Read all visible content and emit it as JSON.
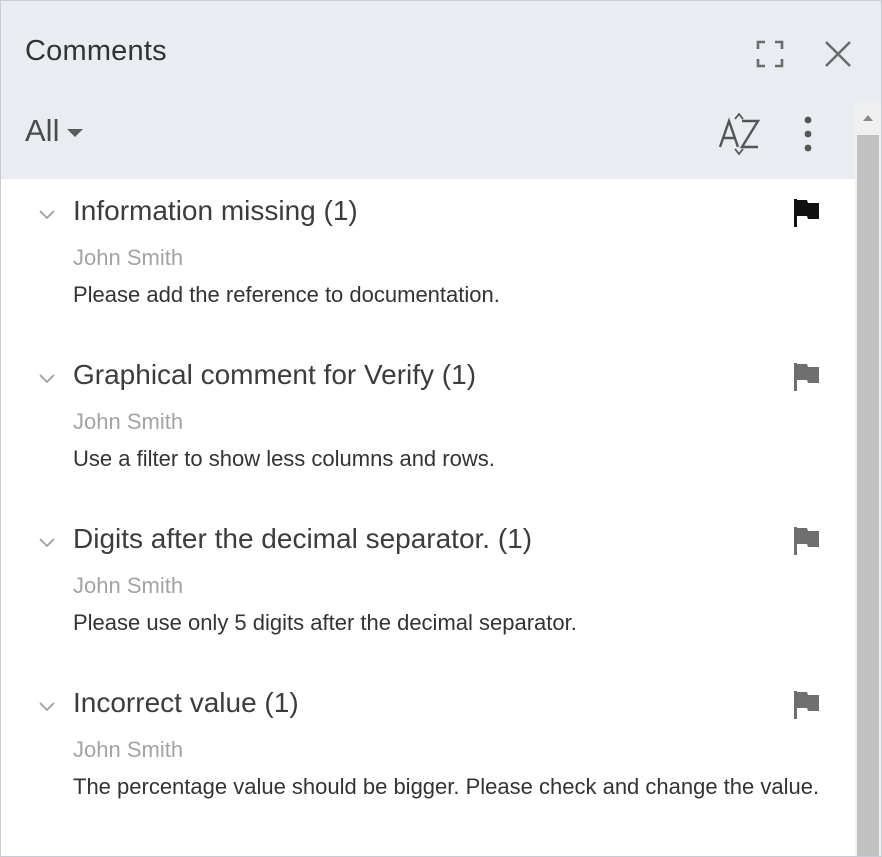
{
  "panel": {
    "title": "Comments",
    "filter": "All",
    "icons": {
      "expand": "expand-icon",
      "close": "close-icon",
      "sort": "sort-az-icon",
      "more": "more-vertical-icon",
      "flag": "flag-icon",
      "chevron": "chevron-down-icon"
    }
  },
  "comments": [
    {
      "title": "Information missing (1)",
      "author": "John Smith",
      "text": "Please add the reference to documentation.",
      "flag_color": "#111111"
    },
    {
      "title": "Graphical comment for Verify (1)",
      "author": "John Smith",
      "text": "Use a filter to show less columns and rows.",
      "flag_color": "#6f6f6f"
    },
    {
      "title": "Digits after the decimal separator. (1)",
      "author": "John Smith",
      "text": "Please use only 5 digits after the decimal separator.",
      "flag_color": "#6f6f6f"
    },
    {
      "title": "Incorrect value (1)",
      "author": "John Smith",
      "text": "The percentage value should be bigger. Please check and change the value.",
      "flag_color": "#6f6f6f"
    }
  ]
}
